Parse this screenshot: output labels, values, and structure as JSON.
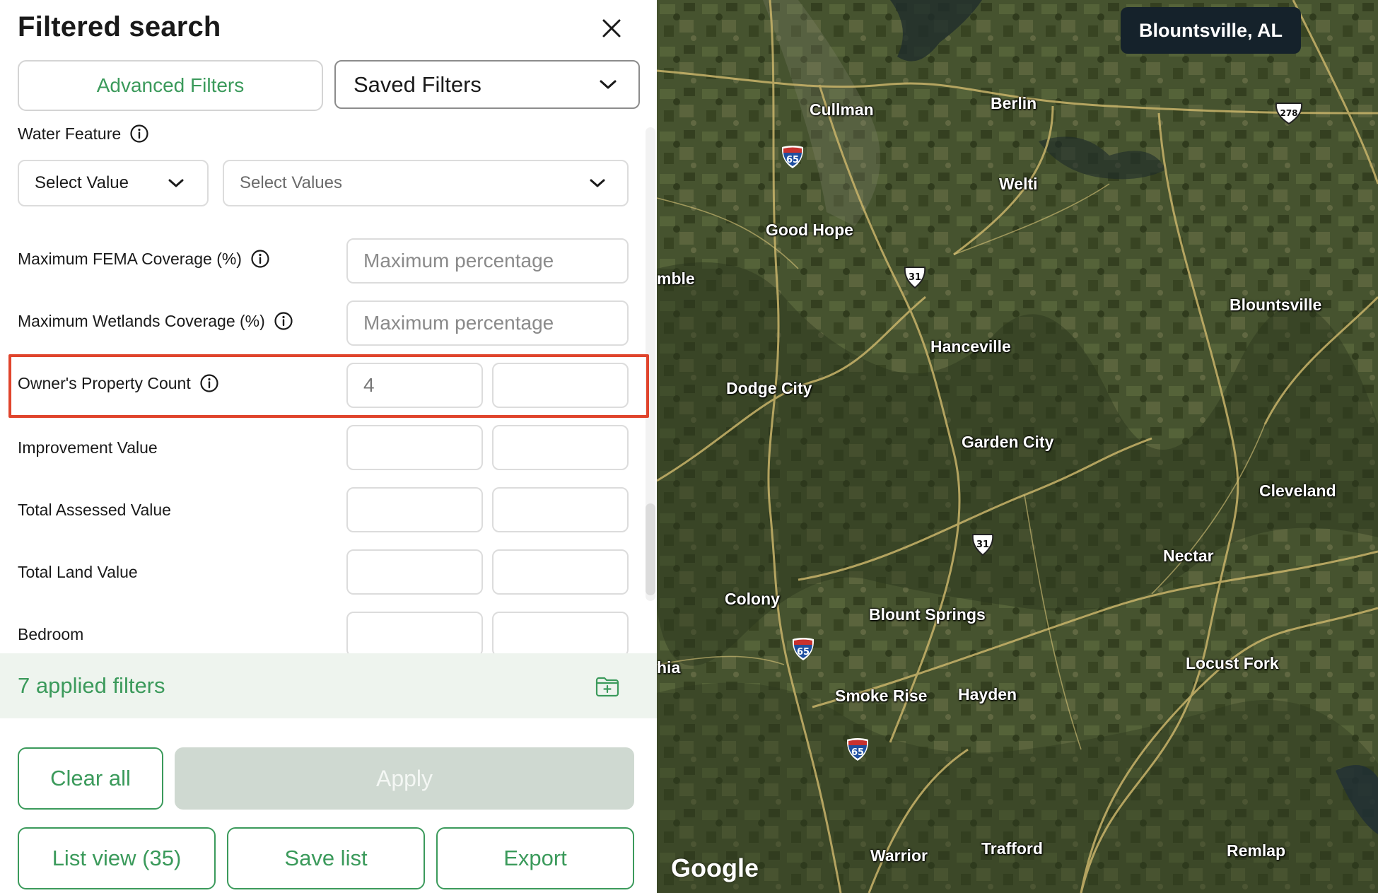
{
  "panel": {
    "title": "Filtered search",
    "tabs": {
      "advanced": "Advanced Filters",
      "saved": "Saved Filters"
    },
    "water_feature": {
      "label": "Water Feature",
      "select_value": "Select Value",
      "select_values_placeholder": "Select Values"
    },
    "rows": {
      "fema": {
        "label": "Maximum FEMA Coverage (%)",
        "placeholder": "Maximum percentage"
      },
      "wetlands": {
        "label": "Maximum Wetlands Coverage (%)",
        "placeholder": "Maximum percentage"
      },
      "owner_count": {
        "label": "Owner's Property Count",
        "min_value": "4",
        "max_value": ""
      },
      "improvement": {
        "label": "Improvement Value"
      },
      "total_assessed": {
        "label": "Total Assessed Value"
      },
      "total_land": {
        "label": "Total Land Value"
      },
      "bedroom": {
        "label": "Bedroom"
      }
    },
    "applied_filters": "7 applied filters",
    "buttons": {
      "clear_all": "Clear all",
      "apply": "Apply",
      "list_view": "List view (35)",
      "save_list": "Save list",
      "export": "Export"
    }
  },
  "map": {
    "location_badge": "Blountsville, AL",
    "attribution": "Google",
    "labels": {
      "cullman": "Cullman",
      "berlin": "Berlin",
      "welti": "Welti",
      "good_hope": "Good Hope",
      "mble": "mble",
      "blountsville": "Blountsville",
      "hanceville": "Hanceville",
      "dodge_city": "Dodge City",
      "garden_city": "Garden City",
      "cleveland": "Cleveland",
      "nectar": "Nectar",
      "colony": "Colony",
      "blount_springs": "Blount Springs",
      "hia": "hia",
      "locust_fork": "Locust Fork",
      "smoke_rise": "Smoke Rise",
      "hayden": "Hayden",
      "warrior": "Warrior",
      "trafford": "Trafford",
      "remlap": "Remlap"
    },
    "shields": {
      "i65": "65",
      "us31": "31",
      "us278": "278"
    }
  },
  "colors": {
    "accent_green": "#3b9a5b",
    "highlight_red": "#e0442c",
    "apply_disabled": "#cfd9d1",
    "badge_bg": "#15222b"
  }
}
